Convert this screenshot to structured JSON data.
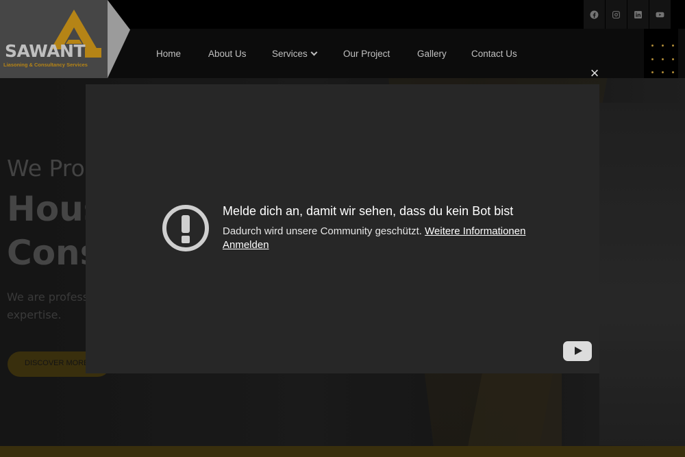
{
  "brand": {
    "name": "SAWANT",
    "tagline": "Liasoning & Consultancy Services",
    "accent_color": "#f2b01e"
  },
  "nav": {
    "items": [
      {
        "label": "Home"
      },
      {
        "label": "About Us"
      },
      {
        "label": "Services"
      },
      {
        "label": "Our Project"
      },
      {
        "label": "Gallery"
      },
      {
        "label": "Contact Us"
      }
    ],
    "menu_icon": "grid-dots-icon"
  },
  "social": [
    "facebook-icon",
    "instagram-icon",
    "linkedin-icon",
    "youtube-icon"
  ],
  "hero": {
    "subtitle": "We Pro",
    "heading_line1": "Hous",
    "heading_line2": "Cons",
    "para_line1": "We are professio",
    "para_line2": "expertise.",
    "cta": "DISCOVER MORE"
  },
  "modal": {
    "close_label": "×",
    "title": "Melde dich an, damit wir sehen, dass du kein Bot bist",
    "body": "Dadurch wird unsere Community geschützt.",
    "more_info_link": "Weitere Informationen",
    "signin_link": "Anmelden",
    "alert_icon": "exclamation-circle-icon",
    "player_icon": "youtube-play-icon"
  }
}
